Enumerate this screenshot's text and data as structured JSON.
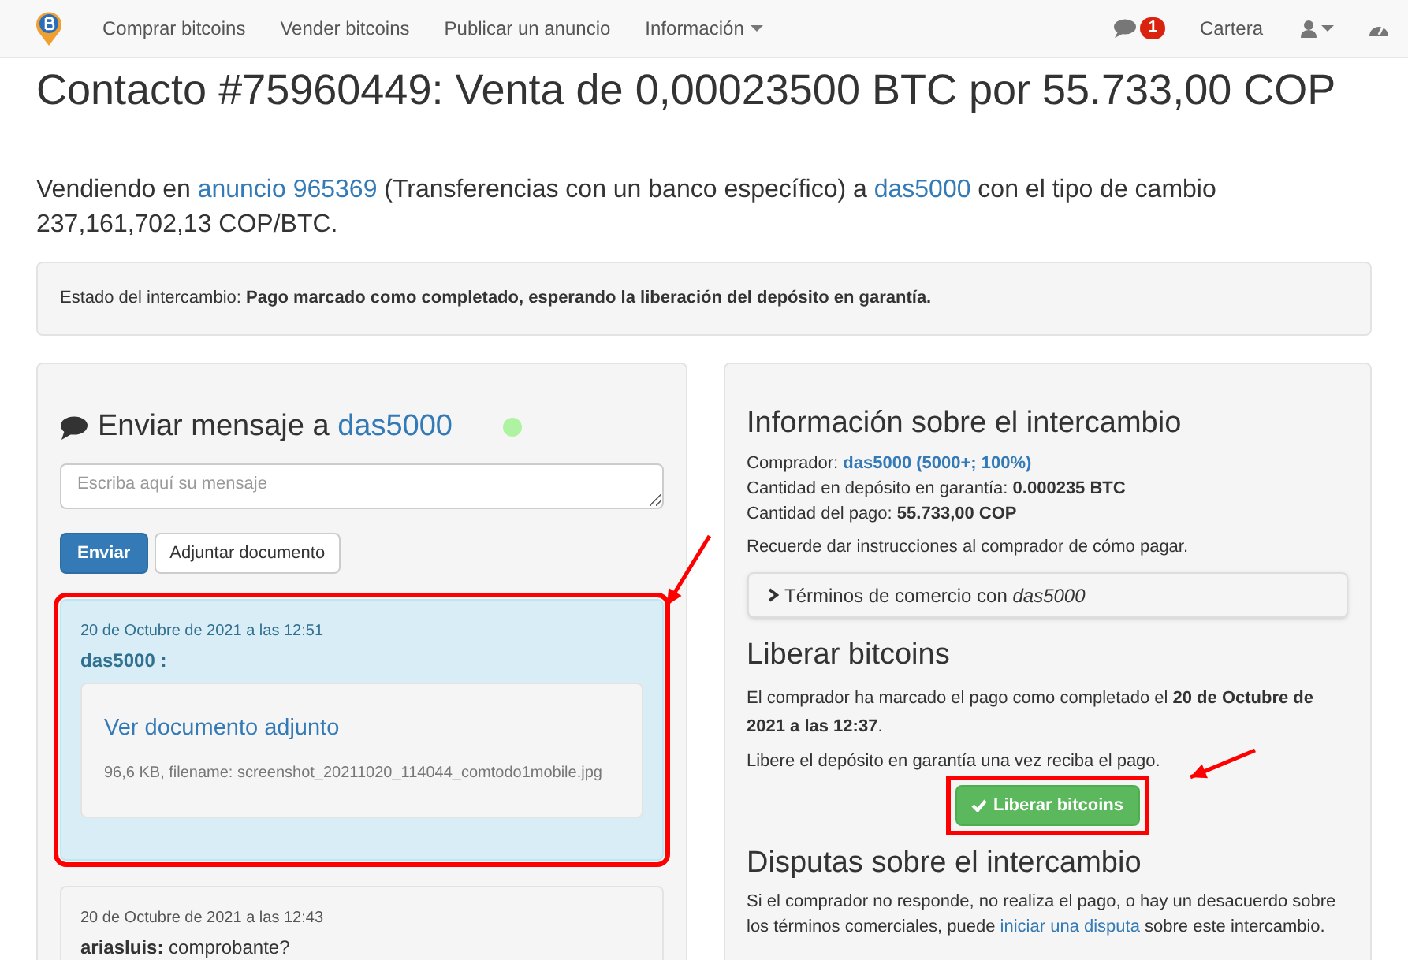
{
  "navbar": {
    "links": [
      {
        "label": "Comprar bitcoins",
        "dropdown": false
      },
      {
        "label": "Vender bitcoins",
        "dropdown": false
      },
      {
        "label": "Publicar un anuncio",
        "dropdown": false
      },
      {
        "label": "Información",
        "dropdown": true
      }
    ],
    "notifications_badge": "1",
    "wallet": "Cartera"
  },
  "title": "Contacto #75960449: Venta de 0,00023500 BTC por 55.733,00 COP",
  "summary": [
    {
      "kind": "text",
      "text": "Vendiendo en "
    },
    {
      "kind": "link",
      "text": "anuncio 965369"
    },
    {
      "kind": "text",
      "text": " (Transferencias con un banco específico) a "
    },
    {
      "kind": "link",
      "text": "das5000"
    },
    {
      "kind": "text",
      "text": " con el tipo de cambio 237,161,702,13 COP/BTC."
    }
  ],
  "status": "Estado del intercambio: **Pago marcado como completado, esperando la liberación del depósito en garantía.**",
  "chat": {
    "heading": "Enviar mensaje a",
    "user": "das5000",
    "online": true,
    "placeholder": "Escriba aquí su mensaje",
    "send": "Enviar",
    "attach": "Adjuntar documento",
    "messages": [
      {
        "kind": "attachment",
        "highlighted": true,
        "time": "20 de Octubre de 2021 a las 12:51",
        "sender": "das5000 :",
        "link": "Ver documento adjunto",
        "file": "96,6 KB, filename: screenshot_20211020_114044_comtodo1mobile.jpg"
      },
      {
        "kind": "text",
        "highlighted": false,
        "time": "20 de Octubre de 2021 a las 12:43",
        "sender": "ariasluis:",
        "text": "comprobante?"
      }
    ]
  },
  "info": {
    "heading": "Información sobre el intercambio",
    "buyer_label": "Comprador: ",
    "buyer": "das5000 (5000+; 100%)",
    "lines": [
      "Cantidad en depósito en garantía: **0.000235 BTC**",
      "Cantidad del pago: **55.733,00 COP**"
    ],
    "note": "Recuerde dar instrucciones al comprador de cómo pagar.",
    "terms": {
      "label": "Términos de comercio con ",
      "user": "das5000",
      "expanded": false
    }
  },
  "release": {
    "heading": "Liberar bitcoins",
    "text": "El comprador ha marcado el pago como completado el **20 de Octubre de 2021 a las 12:37**.",
    "note": "Libere el depósito en garantía una vez reciba el pago.",
    "button": "Liberar bitcoins",
    "highlighted": true
  },
  "dispute": {
    "heading": "Disputas sobre el intercambio",
    "before": "Si el comprador no responde, no realiza el pago, o hay un desacuerdo sobre los términos comerciales, puede ",
    "link": "iniciar una disputa",
    "after": " sobre este intercambio."
  }
}
